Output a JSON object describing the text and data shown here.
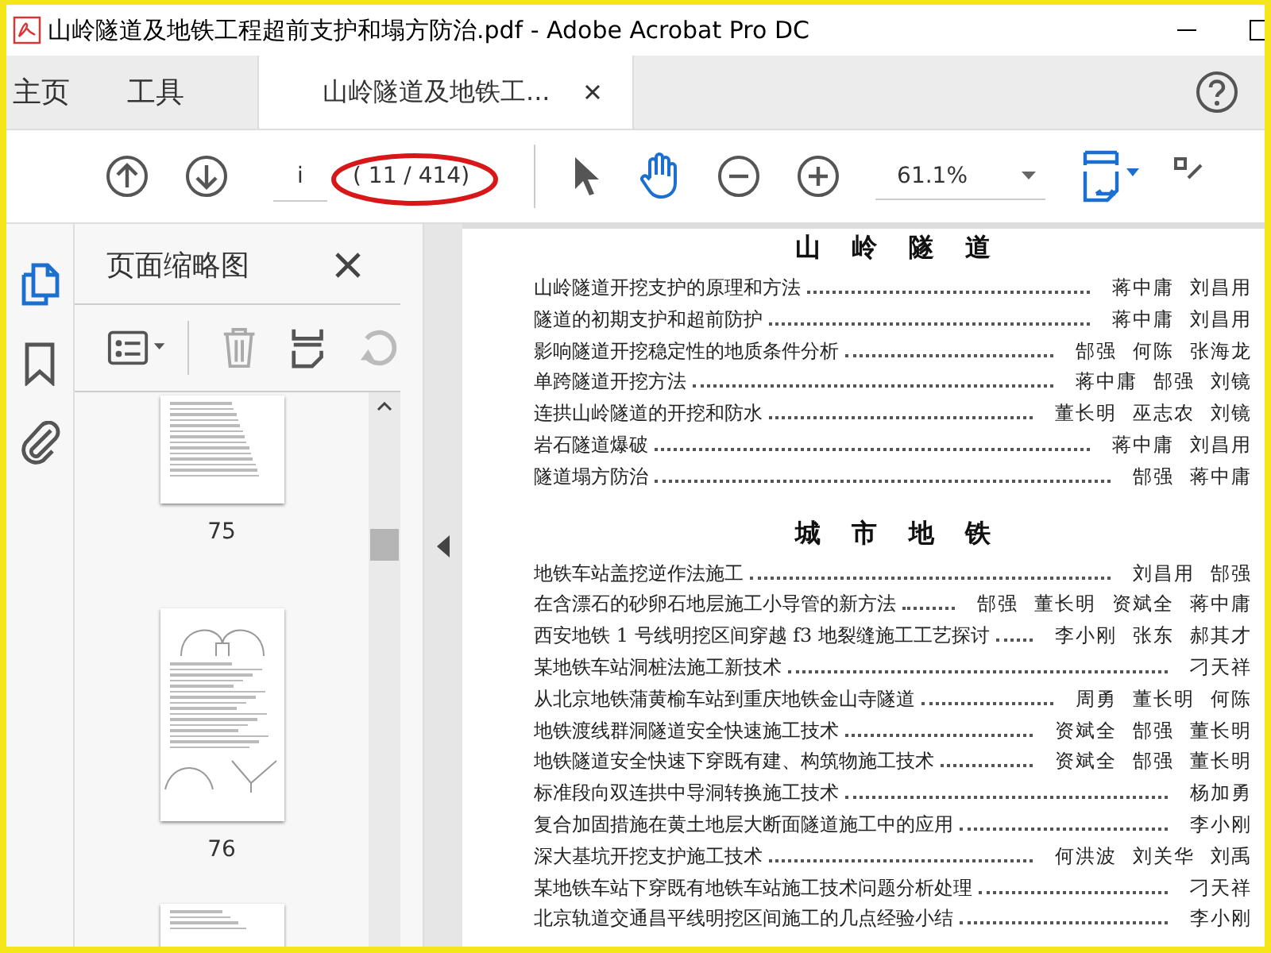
{
  "window": {
    "title": "山岭隧道及地铁工程超前支护和塌方防治.pdf - Adobe Acrobat Pro DC"
  },
  "tabs": [
    {
      "label": "主页",
      "selected": false
    },
    {
      "label": "工具",
      "selected": false
    },
    {
      "label": "山岭隧道及地铁工...",
      "selected": true
    }
  ],
  "toolbar": {
    "page_field": "i",
    "page_count": "( 11 / 414)",
    "zoom": "61.1%"
  },
  "rail": [
    {
      "kind": "pages",
      "selected": true
    },
    {
      "kind": "bookmarks",
      "selected": false
    },
    {
      "kind": "attachments",
      "selected": false
    }
  ],
  "side_panel": {
    "title": "页面缩略图",
    "thumbnails": [
      {
        "page": "75"
      },
      {
        "page": "76"
      }
    ]
  },
  "document": {
    "sections": [
      {
        "heading": "山 岭 隧 道",
        "entries": [
          {
            "title": "山岭隧道开挖支护的原理和方法",
            "authors": [
              "蒋中庸",
              "刘昌用"
            ]
          },
          {
            "title": "隧道的初期支护和超前防护",
            "authors": [
              "蒋中庸",
              "刘昌用"
            ]
          },
          {
            "title": "影响隧道开挖稳定性的地质条件分析",
            "authors": [
              "郜强",
              "何陈",
              "张海龙"
            ]
          },
          {
            "title": "单跨隧道开挖方法",
            "authors": [
              "蒋中庸",
              "郜强",
              "刘镜"
            ]
          },
          {
            "title": "连拱山岭隧道的开挖和防水",
            "authors": [
              "董长明",
              "巫志农",
              "刘镜"
            ]
          },
          {
            "title": "岩石隧道爆破",
            "authors": [
              "蒋中庸",
              "刘昌用"
            ]
          },
          {
            "title": "隧道塌方防治",
            "authors": [
              "郜强",
              "蒋中庸"
            ]
          }
        ]
      },
      {
        "heading": "城 市 地 铁",
        "entries": [
          {
            "title": "地铁车站盖挖逆作法施工",
            "authors": [
              "刘昌用",
              "郜强"
            ]
          },
          {
            "title": "在含漂石的砂卵石地层施工小导管的新方法",
            "authors": [
              "郜强",
              "董长明",
              "资斌全",
              "蒋中庸"
            ]
          },
          {
            "title": "西安地铁 1 号线明挖区间穿越 f3 地裂缝施工工艺探讨",
            "authors": [
              "李小刚",
              "张东",
              "郝其才"
            ]
          },
          {
            "title": "某地铁车站洞桩法施工新技术",
            "authors": [
              "刁天祥"
            ]
          },
          {
            "title": "从北京地铁蒲黄榆车站到重庆地铁金山寺隧道",
            "authors": [
              "周勇",
              "董长明",
              "何陈"
            ]
          },
          {
            "title": "地铁渡线群洞隧道安全快速施工技术",
            "authors": [
              "资斌全",
              "郜强",
              "董长明"
            ]
          },
          {
            "title": "地铁隧道安全快速下穿既有建、构筑物施工技术",
            "authors": [
              "资斌全",
              "郜强",
              "董长明"
            ]
          },
          {
            "title": "标准段向双连拱中导洞转换施工技术",
            "authors": [
              "杨加勇"
            ]
          },
          {
            "title": "复合加固措施在黄土地层大断面隧道施工中的应用",
            "authors": [
              "李小刚"
            ]
          },
          {
            "title": "深大基坑开挖支护施工技术",
            "authors": [
              "何洪波",
              "刘关华",
              "刘禹"
            ]
          },
          {
            "title": "某地铁车站下穿既有地铁车站施工技术问题分析处理",
            "authors": [
              "刁天祥"
            ]
          },
          {
            "title": "北京轨道交通昌平线明挖区间施工的几点经验小结",
            "authors": [
              "李小刚"
            ]
          }
        ]
      }
    ]
  }
}
